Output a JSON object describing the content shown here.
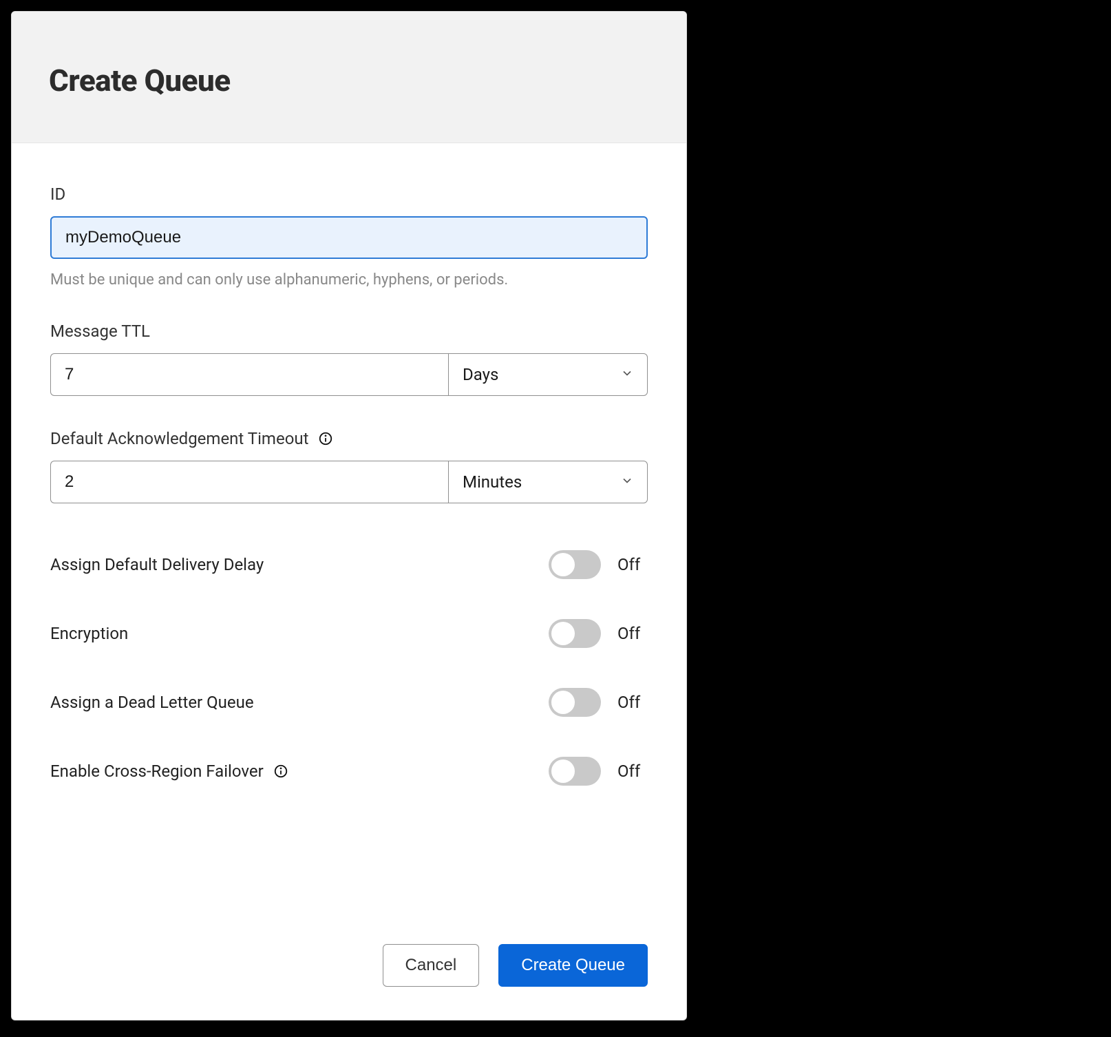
{
  "header": {
    "title": "Create Queue"
  },
  "fields": {
    "id": {
      "label": "ID",
      "value": "myDemoQueue",
      "help": "Must be unique and can only use alphanumeric, hyphens, or periods."
    },
    "ttl": {
      "label": "Message TTL",
      "value": "7",
      "unit": "Days"
    },
    "ack": {
      "label": "Default Acknowledgement Timeout",
      "value": "2",
      "unit": "Minutes"
    }
  },
  "toggles": {
    "delivery_delay": {
      "label": "Assign Default Delivery Delay",
      "state": "Off"
    },
    "encryption": {
      "label": "Encryption",
      "state": "Off"
    },
    "dlq": {
      "label": "Assign a Dead Letter Queue",
      "state": "Off"
    },
    "crossregion": {
      "label": "Enable Cross-Region Failover",
      "state": "Off"
    }
  },
  "actions": {
    "cancel": "Cancel",
    "submit": "Create Queue"
  }
}
